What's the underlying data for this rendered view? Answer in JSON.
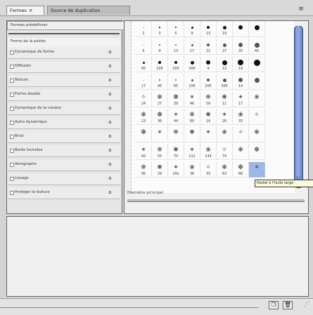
{
  "tabs": {
    "formes": "Formes",
    "close": "×",
    "source": "Source de duplication",
    "menu_icon": "panel-menu-icon"
  },
  "left_panel": {
    "presets": "Formes prédéfinies",
    "shape_header": "Forme de la pointe",
    "options": [
      {
        "label": "Dynamique de forme"
      },
      {
        "label": "Diffusion"
      },
      {
        "label": "Texture"
      },
      {
        "label": "Forme double"
      },
      {
        "label": "Dynamique de la couleur"
      },
      {
        "label": "Autre dynamique"
      },
      {
        "label": "Bruit"
      },
      {
        "label": "Bords humides"
      },
      {
        "label": "Aérographe"
      },
      {
        "label": "Lissage"
      },
      {
        "label": "Protéger la texture"
      }
    ]
  },
  "brushes": {
    "row_numbers": [
      [
        "1",
        "3",
        "5",
        "9",
        "13",
        "19",
        "",
        ""
      ],
      [
        "5",
        "9",
        "13",
        "17",
        "21",
        "27",
        "35",
        "45"
      ],
      [
        "65",
        "100",
        "200",
        "300",
        "9",
        "13",
        "19",
        ""
      ],
      [
        "17",
        "45",
        "65",
        "100",
        "200",
        "300",
        "14",
        ""
      ],
      [
        "24",
        "27",
        "39",
        "46",
        "59",
        "11",
        "17",
        ""
      ],
      [
        "23",
        "36",
        "44",
        "60",
        "14",
        "26",
        "33",
        ""
      ],
      [
        "",
        "",
        "",
        "",
        "",
        "",
        "",
        ""
      ],
      [
        "42",
        "55",
        "70",
        "112",
        "134",
        "74",
        "",
        " "
      ],
      [
        "95",
        "29",
        "192",
        "36",
        "33",
        "63",
        "66",
        ""
      ]
    ]
  },
  "tooltip": "Pastel à l'huile large",
  "diameter_label": "Diamètre principal",
  "colors": {
    "accent": "#6f8cd1",
    "selection": "#9bb8e8"
  }
}
